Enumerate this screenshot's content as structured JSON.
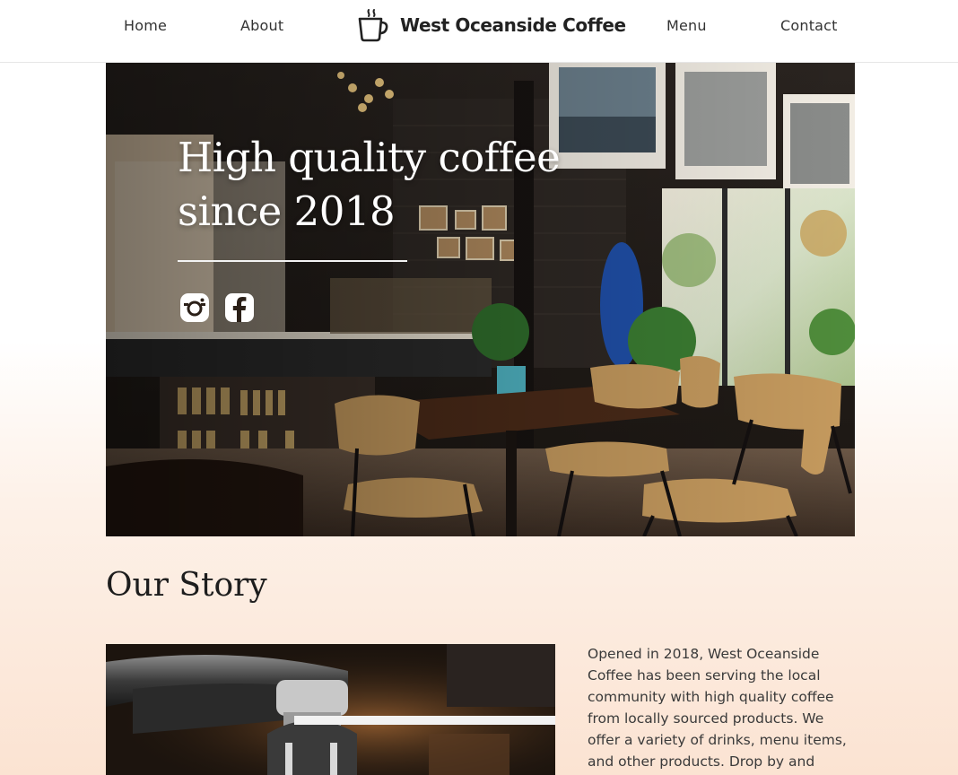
{
  "nav": {
    "links": [
      "Home",
      "About",
      "Menu",
      "Contact"
    ],
    "brand": "West Oceanside Coffee",
    "brand_icon": "coffee-cup-icon"
  },
  "hero": {
    "title_line1": "High quality coffee",
    "title_line2": "since 2018",
    "social_icons": [
      "instagram-icon",
      "facebook-icon"
    ]
  },
  "story": {
    "heading": "Our Story",
    "text": "Opened in 2018, West Oceanside Coffee has been serving the local community with high quality coffee from locally sourced products. We offer a variety of drinks, menu items, and other products. Drop by and"
  },
  "colors": {
    "text_dark": "#222222",
    "page_gradient_bottom": "#fbe3d2",
    "hero_text": "#ffffff"
  }
}
